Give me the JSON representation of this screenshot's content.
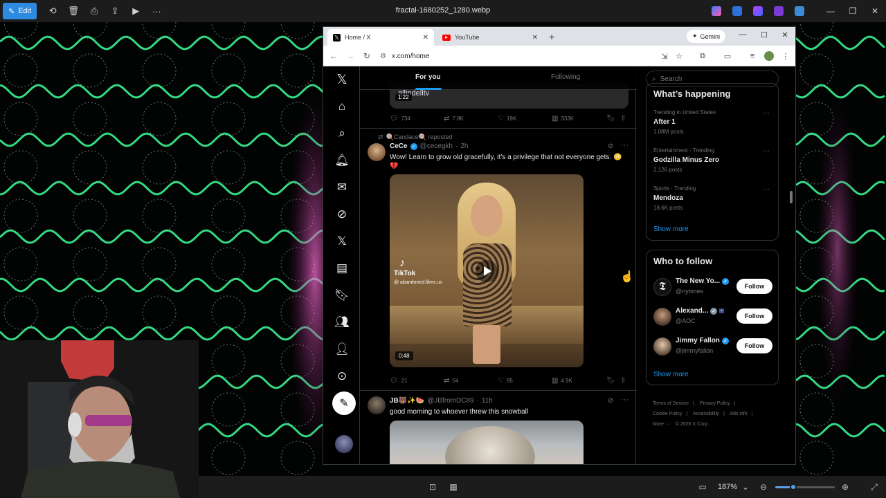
{
  "viewer": {
    "edit_label": "Edit",
    "title": "fractal-1680252_1280.webp",
    "zoom_label": "187%",
    "zoom_fraction": 0.3
  },
  "browser": {
    "tabs": [
      {
        "label": "Home / X"
      },
      {
        "label": "YouTube"
      }
    ],
    "gemini_label": "Gemini",
    "url": "x.com/home"
  },
  "feed": {
    "tab_for_you": "For you",
    "tab_following": "Following",
    "prev_post": {
      "handle_fragment": "allindelltv",
      "duration": "1:22",
      "replies": "734",
      "reposts": "7.8K",
      "likes": "19K",
      "views": "333K"
    },
    "post1": {
      "repost_by": "🍭Candace🍭 reposted",
      "name": "CeCe",
      "handle": "@cecegkh",
      "time": "2h",
      "text": "Wow! Learn to grow old gracefully, it’s a privilege that not everyone gets. 😳 💔",
      "tiktok_label": "TikTok",
      "tiktok_handle": "@ abandoned.films.us",
      "duration": "0:48",
      "replies": "21",
      "reposts": "54",
      "likes": "95",
      "views": "4.9K"
    },
    "post2": {
      "name": "JB🐻✨🍉",
      "handle": "@JBfromDC89",
      "time": "11h",
      "text": "good morning to whoever threw this snowball"
    }
  },
  "sidebar": {
    "search_placeholder": "Search",
    "happening_title": "What’s happening",
    "trends": [
      {
        "meta": "Trending in United States",
        "name": "After 1",
        "posts": "1.08M posts"
      },
      {
        "meta": "Entertainment · Trending",
        "name": "Godzilla Minus Zero",
        "posts": "2,126 posts"
      },
      {
        "meta": "Sports · Trending",
        "name": "Mendoza",
        "posts": "18.6K posts"
      }
    ],
    "show_more": "Show more",
    "follow_title": "Who to follow",
    "follow": [
      {
        "name": "The New Yo...",
        "handle": "@nytimes",
        "button": "Follow"
      },
      {
        "name": "Alexand...",
        "handle": "@AOC",
        "button": "Follow"
      },
      {
        "name": "Jimmy Fallon",
        "handle": "@jimmyfallon",
        "button": "Follow"
      }
    ],
    "footer": {
      "terms": "Terms of Service",
      "privacy": "Privacy Policy",
      "cookie": "Cookie Policy",
      "accessibility": "Accessibility",
      "ads": "Ads info",
      "more": "More ···",
      "copyright": "© 2026 X Corp."
    }
  },
  "colors": {
    "accent": "#1d9bf0",
    "fractal_green": "#3dff9a",
    "fractal_pink": "#e050c0"
  }
}
